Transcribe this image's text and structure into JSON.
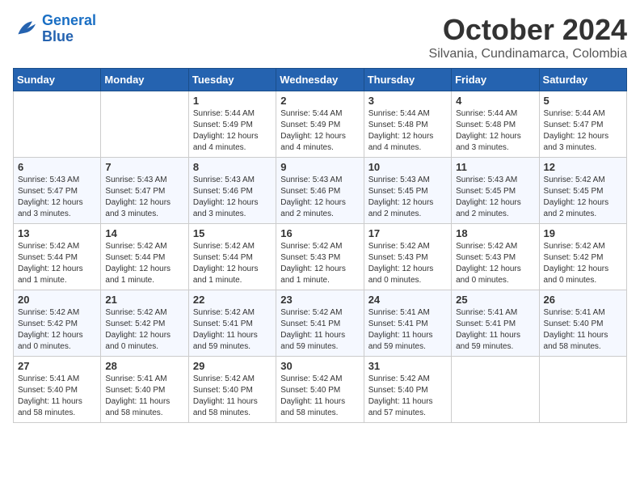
{
  "header": {
    "logo_line1": "General",
    "logo_line2": "Blue",
    "month": "October 2024",
    "location": "Silvania, Cundinamarca, Colombia"
  },
  "days_of_week": [
    "Sunday",
    "Monday",
    "Tuesday",
    "Wednesday",
    "Thursday",
    "Friday",
    "Saturday"
  ],
  "weeks": [
    [
      {
        "day": "",
        "info": ""
      },
      {
        "day": "",
        "info": ""
      },
      {
        "day": "1",
        "info": "Sunrise: 5:44 AM\nSunset: 5:49 PM\nDaylight: 12 hours\nand 4 minutes."
      },
      {
        "day": "2",
        "info": "Sunrise: 5:44 AM\nSunset: 5:49 PM\nDaylight: 12 hours\nand 4 minutes."
      },
      {
        "day": "3",
        "info": "Sunrise: 5:44 AM\nSunset: 5:48 PM\nDaylight: 12 hours\nand 4 minutes."
      },
      {
        "day": "4",
        "info": "Sunrise: 5:44 AM\nSunset: 5:48 PM\nDaylight: 12 hours\nand 3 minutes."
      },
      {
        "day": "5",
        "info": "Sunrise: 5:44 AM\nSunset: 5:47 PM\nDaylight: 12 hours\nand 3 minutes."
      }
    ],
    [
      {
        "day": "6",
        "info": "Sunrise: 5:43 AM\nSunset: 5:47 PM\nDaylight: 12 hours\nand 3 minutes."
      },
      {
        "day": "7",
        "info": "Sunrise: 5:43 AM\nSunset: 5:47 PM\nDaylight: 12 hours\nand 3 minutes."
      },
      {
        "day": "8",
        "info": "Sunrise: 5:43 AM\nSunset: 5:46 PM\nDaylight: 12 hours\nand 3 minutes."
      },
      {
        "day": "9",
        "info": "Sunrise: 5:43 AM\nSunset: 5:46 PM\nDaylight: 12 hours\nand 2 minutes."
      },
      {
        "day": "10",
        "info": "Sunrise: 5:43 AM\nSunset: 5:45 PM\nDaylight: 12 hours\nand 2 minutes."
      },
      {
        "day": "11",
        "info": "Sunrise: 5:43 AM\nSunset: 5:45 PM\nDaylight: 12 hours\nand 2 minutes."
      },
      {
        "day": "12",
        "info": "Sunrise: 5:42 AM\nSunset: 5:45 PM\nDaylight: 12 hours\nand 2 minutes."
      }
    ],
    [
      {
        "day": "13",
        "info": "Sunrise: 5:42 AM\nSunset: 5:44 PM\nDaylight: 12 hours\nand 1 minute."
      },
      {
        "day": "14",
        "info": "Sunrise: 5:42 AM\nSunset: 5:44 PM\nDaylight: 12 hours\nand 1 minute."
      },
      {
        "day": "15",
        "info": "Sunrise: 5:42 AM\nSunset: 5:44 PM\nDaylight: 12 hours\nand 1 minute."
      },
      {
        "day": "16",
        "info": "Sunrise: 5:42 AM\nSunset: 5:43 PM\nDaylight: 12 hours\nand 1 minute."
      },
      {
        "day": "17",
        "info": "Sunrise: 5:42 AM\nSunset: 5:43 PM\nDaylight: 12 hours\nand 0 minutes."
      },
      {
        "day": "18",
        "info": "Sunrise: 5:42 AM\nSunset: 5:43 PM\nDaylight: 12 hours\nand 0 minutes."
      },
      {
        "day": "19",
        "info": "Sunrise: 5:42 AM\nSunset: 5:42 PM\nDaylight: 12 hours\nand 0 minutes."
      }
    ],
    [
      {
        "day": "20",
        "info": "Sunrise: 5:42 AM\nSunset: 5:42 PM\nDaylight: 12 hours\nand 0 minutes."
      },
      {
        "day": "21",
        "info": "Sunrise: 5:42 AM\nSunset: 5:42 PM\nDaylight: 12 hours\nand 0 minutes."
      },
      {
        "day": "22",
        "info": "Sunrise: 5:42 AM\nSunset: 5:41 PM\nDaylight: 11 hours\nand 59 minutes."
      },
      {
        "day": "23",
        "info": "Sunrise: 5:42 AM\nSunset: 5:41 PM\nDaylight: 11 hours\nand 59 minutes."
      },
      {
        "day": "24",
        "info": "Sunrise: 5:41 AM\nSunset: 5:41 PM\nDaylight: 11 hours\nand 59 minutes."
      },
      {
        "day": "25",
        "info": "Sunrise: 5:41 AM\nSunset: 5:41 PM\nDaylight: 11 hours\nand 59 minutes."
      },
      {
        "day": "26",
        "info": "Sunrise: 5:41 AM\nSunset: 5:40 PM\nDaylight: 11 hours\nand 58 minutes."
      }
    ],
    [
      {
        "day": "27",
        "info": "Sunrise: 5:41 AM\nSunset: 5:40 PM\nDaylight: 11 hours\nand 58 minutes."
      },
      {
        "day": "28",
        "info": "Sunrise: 5:41 AM\nSunset: 5:40 PM\nDaylight: 11 hours\nand 58 minutes."
      },
      {
        "day": "29",
        "info": "Sunrise: 5:42 AM\nSunset: 5:40 PM\nDaylight: 11 hours\nand 58 minutes."
      },
      {
        "day": "30",
        "info": "Sunrise: 5:42 AM\nSunset: 5:40 PM\nDaylight: 11 hours\nand 58 minutes."
      },
      {
        "day": "31",
        "info": "Sunrise: 5:42 AM\nSunset: 5:40 PM\nDaylight: 11 hours\nand 57 minutes."
      },
      {
        "day": "",
        "info": ""
      },
      {
        "day": "",
        "info": ""
      }
    ]
  ]
}
